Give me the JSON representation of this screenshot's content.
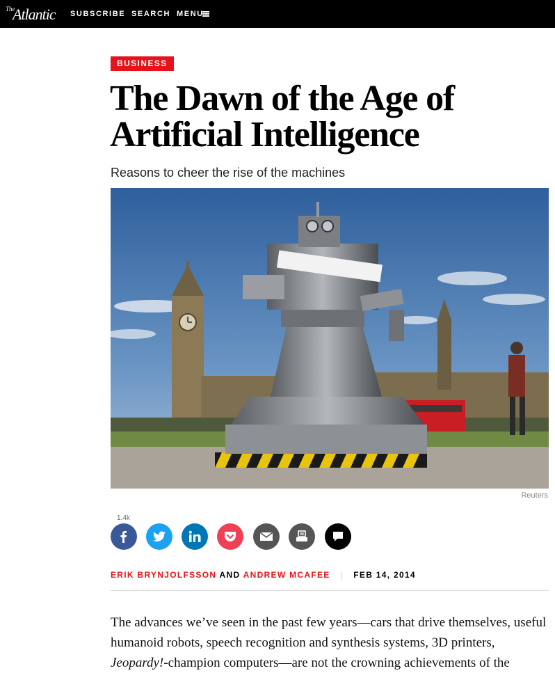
{
  "header": {
    "logo_the": "The",
    "logo_name": "Atlantic",
    "subscribe": "SUBSCRIBE",
    "search": "SEARCH",
    "menu": "MENU"
  },
  "article": {
    "section_tag": "BUSINESS",
    "title_line1": "The Dawn of the Age of",
    "title_line2": "Artificial Intelligence",
    "dek": "Reasons to cheer the rise of the machines",
    "photo_credit": "Reuters",
    "share_count": "1.4k",
    "author1": "ERIK BRYNJOLFSSON",
    "and": "AND",
    "author2": "ANDREW MCAFEE",
    "separator": "|",
    "date": "FEB 14, 2014",
    "body_part1": "The advances we’ve seen in the past few years—cars that drive themselves, useful humanoid robots, speech recognition and synthesis systems, 3D printers, ",
    "body_italic": "Jeopardy!",
    "body_part2": "-champion computers—are not the crowning achievements of the"
  },
  "share_buttons": [
    {
      "name": "facebook",
      "color": "#3b5998"
    },
    {
      "name": "twitter",
      "color": "#1da1f2"
    },
    {
      "name": "linkedin",
      "color": "#0077b5"
    },
    {
      "name": "pocket",
      "color": "#ef4056"
    },
    {
      "name": "email",
      "color": "#555555"
    },
    {
      "name": "print",
      "color": "#555555"
    },
    {
      "name": "comments",
      "color": "#000000"
    }
  ],
  "colors": {
    "accent": "#e7131a",
    "topbar": "#000000"
  }
}
